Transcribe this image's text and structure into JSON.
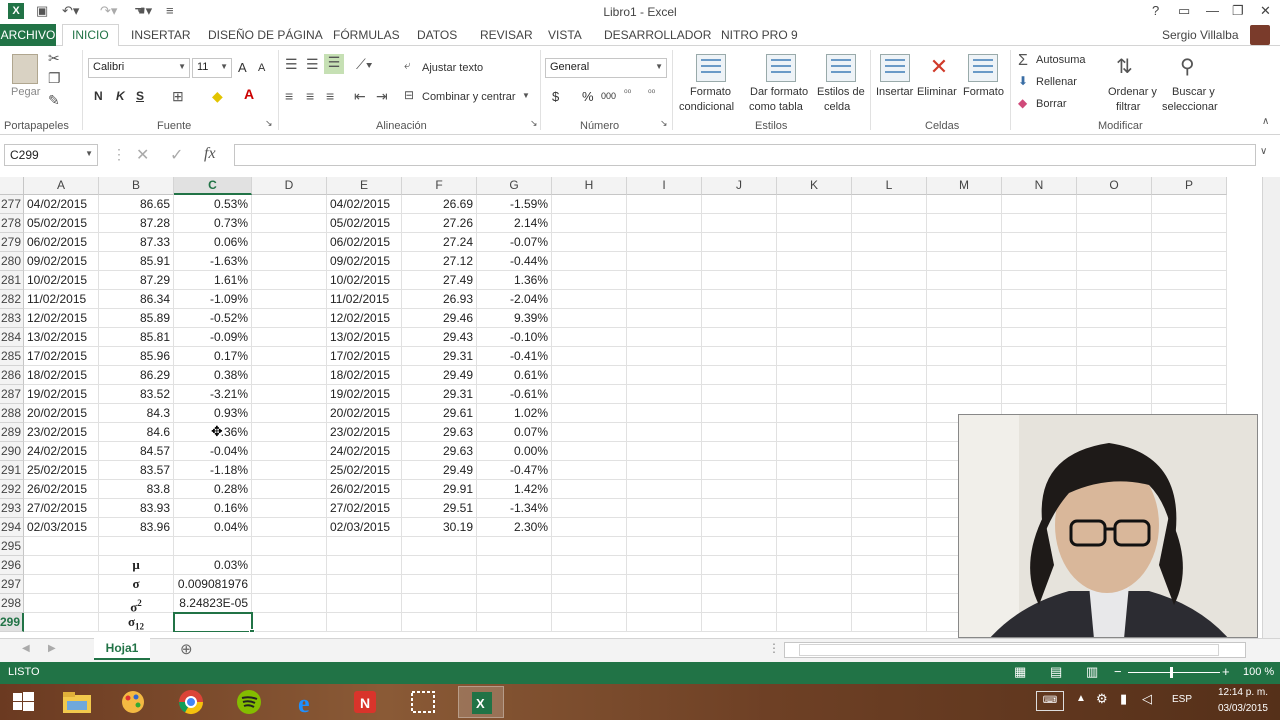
{
  "window": {
    "title": "Libro1 - Excel",
    "user": "Sergio Villalba",
    "help": "?",
    "minimize": "—",
    "restore": "❐",
    "close": "✕"
  },
  "tabs": {
    "file": "ARCHIVO",
    "items": [
      "INICIO",
      "INSERTAR",
      "DISEÑO DE PÁGINA",
      "FÓRMULAS",
      "DATOS",
      "REVISAR",
      "VISTA",
      "DESARROLLADOR",
      "NITRO PRO 9"
    ],
    "active": "INICIO"
  },
  "ribbon": {
    "clipboard": {
      "paste": "Pegar",
      "label": "Portapapeles"
    },
    "font": {
      "name": "Calibri",
      "size": "11",
      "bold": "N",
      "italic": "K",
      "underline": "S",
      "grow": "A",
      "shrink": "A",
      "label": "Fuente"
    },
    "alignment": {
      "wrap": "Ajustar texto",
      "merge": "Combinar y centrar",
      "label": "Alineación"
    },
    "number": {
      "format": "General",
      "currency": "$",
      "percent": "%",
      "thousands": "000",
      "label": "Número"
    },
    "styles": {
      "conditional": [
        "Formato",
        "condicional"
      ],
      "table": [
        "Dar formato",
        "como tabla"
      ],
      "cell": [
        "Estilos de",
        "celda"
      ],
      "label": "Estilos"
    },
    "cells": {
      "insert": "Insertar",
      "delete": "Eliminar",
      "format": "Formato",
      "label": "Celdas"
    },
    "editing": {
      "autosum": "Autosuma",
      "fill": "Rellenar",
      "clear": "Borrar",
      "sort": [
        "Ordenar y",
        "filtrar"
      ],
      "find": [
        "Buscar y",
        "seleccionar"
      ],
      "label": "Modificar"
    }
  },
  "formula_bar": {
    "name_box": "C299",
    "fx": "fx",
    "content": ""
  },
  "columns": [
    "A",
    "B",
    "C",
    "D",
    "E",
    "F",
    "G",
    "H",
    "I",
    "J",
    "K",
    "L",
    "M",
    "N",
    "O",
    "P"
  ],
  "selected_column": "C",
  "rows": [
    {
      "n": "277",
      "a": "04/02/2015",
      "b": "86.65",
      "c": "0.53%",
      "e": "04/02/2015",
      "f": "26.69",
      "g": "-1.59%"
    },
    {
      "n": "278",
      "a": "05/02/2015",
      "b": "87.28",
      "c": "0.73%",
      "e": "05/02/2015",
      "f": "27.26",
      "g": "2.14%"
    },
    {
      "n": "279",
      "a": "06/02/2015",
      "b": "87.33",
      "c": "0.06%",
      "e": "06/02/2015",
      "f": "27.24",
      "g": "-0.07%"
    },
    {
      "n": "280",
      "a": "09/02/2015",
      "b": "85.91",
      "c": "-1.63%",
      "e": "09/02/2015",
      "f": "27.12",
      "g": "-0.44%"
    },
    {
      "n": "281",
      "a": "10/02/2015",
      "b": "87.29",
      "c": "1.61%",
      "e": "10/02/2015",
      "f": "27.49",
      "g": "1.36%"
    },
    {
      "n": "282",
      "a": "11/02/2015",
      "b": "86.34",
      "c": "-1.09%",
      "e": "11/02/2015",
      "f": "26.93",
      "g": "-2.04%"
    },
    {
      "n": "283",
      "a": "12/02/2015",
      "b": "85.89",
      "c": "-0.52%",
      "e": "12/02/2015",
      "f": "29.46",
      "g": "9.39%"
    },
    {
      "n": "284",
      "a": "13/02/2015",
      "b": "85.81",
      "c": "-0.09%",
      "e": "13/02/2015",
      "f": "29.43",
      "g": "-0.10%"
    },
    {
      "n": "285",
      "a": "17/02/2015",
      "b": "85.96",
      "c": "0.17%",
      "e": "17/02/2015",
      "f": "29.31",
      "g": "-0.41%"
    },
    {
      "n": "286",
      "a": "18/02/2015",
      "b": "86.29",
      "c": "0.38%",
      "e": "18/02/2015",
      "f": "29.49",
      "g": "0.61%"
    },
    {
      "n": "287",
      "a": "19/02/2015",
      "b": "83.52",
      "c": "-3.21%",
      "e": "19/02/2015",
      "f": "29.31",
      "g": "-0.61%"
    },
    {
      "n": "288",
      "a": "20/02/2015",
      "b": "84.3",
      "c": "0.93%",
      "e": "20/02/2015",
      "f": "29.61",
      "g": "1.02%"
    },
    {
      "n": "289",
      "a": "23/02/2015",
      "b": "84.6",
      "c": ".36%",
      "e": "23/02/2015",
      "f": "29.63",
      "g": "0.07%"
    },
    {
      "n": "290",
      "a": "24/02/2015",
      "b": "84.57",
      "c": "-0.04%",
      "e": "24/02/2015",
      "f": "29.63",
      "g": "0.00%"
    },
    {
      "n": "291",
      "a": "25/02/2015",
      "b": "83.57",
      "c": "-1.18%",
      "e": "25/02/2015",
      "f": "29.49",
      "g": "-0.47%"
    },
    {
      "n": "292",
      "a": "26/02/2015",
      "b": "83.8",
      "c": "0.28%",
      "e": "26/02/2015",
      "f": "29.91",
      "g": "1.42%"
    },
    {
      "n": "293",
      "a": "27/02/2015",
      "b": "83.93",
      "c": "0.16%",
      "e": "27/02/2015",
      "f": "29.51",
      "g": "-1.34%"
    },
    {
      "n": "294",
      "a": "02/03/2015",
      "b": "83.96",
      "c": "0.04%",
      "e": "02/03/2015",
      "f": "30.19",
      "g": "2.30%"
    },
    {
      "n": "295",
      "a": "",
      "b": "",
      "c": "",
      "e": "",
      "f": "",
      "g": ""
    },
    {
      "n": "296",
      "a": "",
      "b": "μ",
      "c": "0.03%",
      "e": "",
      "f": "",
      "g": ""
    },
    {
      "n": "297",
      "a": "",
      "b": "σ",
      "c": "0.009081976",
      "e": "",
      "f": "",
      "g": ""
    },
    {
      "n": "298",
      "a": "",
      "b": "σ",
      "b_sup": "2",
      "c": "8.24823E-05",
      "e": "",
      "f": "",
      "g": ""
    },
    {
      "n": "299",
      "a": "",
      "b": "σ",
      "b_sub": "12",
      "c": "",
      "e": "",
      "f": "",
      "g": ""
    }
  ],
  "sheet": {
    "tab": "Hoja1",
    "add": "⊕"
  },
  "status": {
    "ready": "LISTO",
    "zoom": "100 %"
  },
  "taskbar": {
    "language": "ESP",
    "time": "12:14 p. m.",
    "date": "03/03/2015"
  },
  "colors": {
    "excel_green": "#217346"
  }
}
